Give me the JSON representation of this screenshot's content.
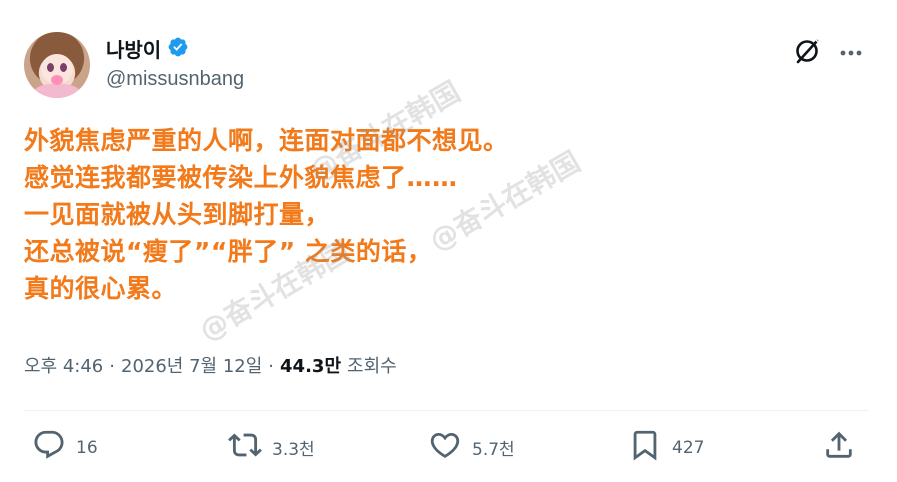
{
  "author": {
    "display_name": "나방이",
    "handle": "@missusnbang",
    "verified": true,
    "verified_color": "#1d9bf0"
  },
  "tweet": {
    "lines": [
      "外貌焦虑严重的人啊，连面对面都不想见。",
      "感觉连我都要被传染上外貌焦虑了……",
      "一见面就被从头到脚打量，",
      "还总被说“瘦了”“胖了” 之类的话，",
      "真的很心累。"
    ],
    "text_color": "#f27a1a"
  },
  "watermark": {
    "text": "@奋斗在韩国"
  },
  "meta": {
    "time": "오후 4:46",
    "separator": "·",
    "date": "2026년 7월 12일",
    "views_count": "44.3만",
    "views_label": "조회수"
  },
  "actions": {
    "reply_count": "16",
    "retweet_count": "3.3천",
    "like_count": "5.7천",
    "bookmark_count": "427"
  },
  "icons": {
    "grok": "grok-icon",
    "more": "more-icon",
    "reply": "reply-icon",
    "retweet": "retweet-icon",
    "like": "heart-icon",
    "bookmark": "bookmark-icon",
    "share": "share-icon"
  }
}
